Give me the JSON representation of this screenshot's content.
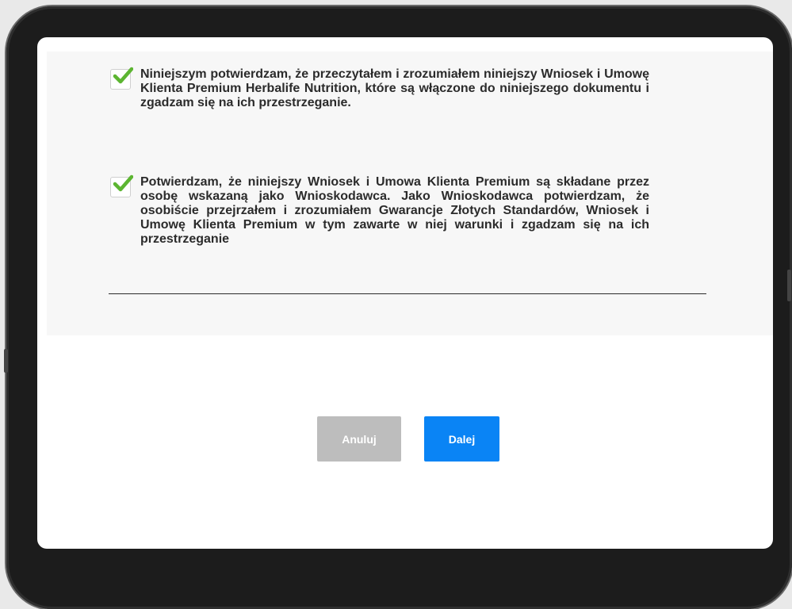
{
  "consents": [
    {
      "checked": true,
      "text": "Niniejszym potwierdzam, że przeczytałem i zrozumiałem niniejszy Wniosek i Umowę Klienta Premium Herbalife Nutrition, które są włączone do niniejszego dokumentu i zgadzam się na ich przestrzeganie."
    },
    {
      "checked": true,
      "text": "Potwierdzam, że niniejszy Wniosek i Umowa Klienta Premium są składane przez osobę wskazaną jako Wnioskodawca. Jako Wnioskodawca potwierdzam, że osobiście przejrzałem i zrozumiałem Gwarancje Złotych Standardów, Wniosek i Umowę Klienta Premium w tym zawarte w niej warunki i zgadzam się na ich przestrzeganie"
    }
  ],
  "buttons": {
    "cancel_label": "Anuluj",
    "next_label": "Dalej"
  },
  "colors": {
    "check": "#5cb531",
    "primary": "#0a84f5",
    "secondary": "#bdbdbd",
    "panel": "#f7f7f7",
    "text": "#2b2b2b"
  },
  "icons": {
    "check": "checkmark-icon"
  }
}
